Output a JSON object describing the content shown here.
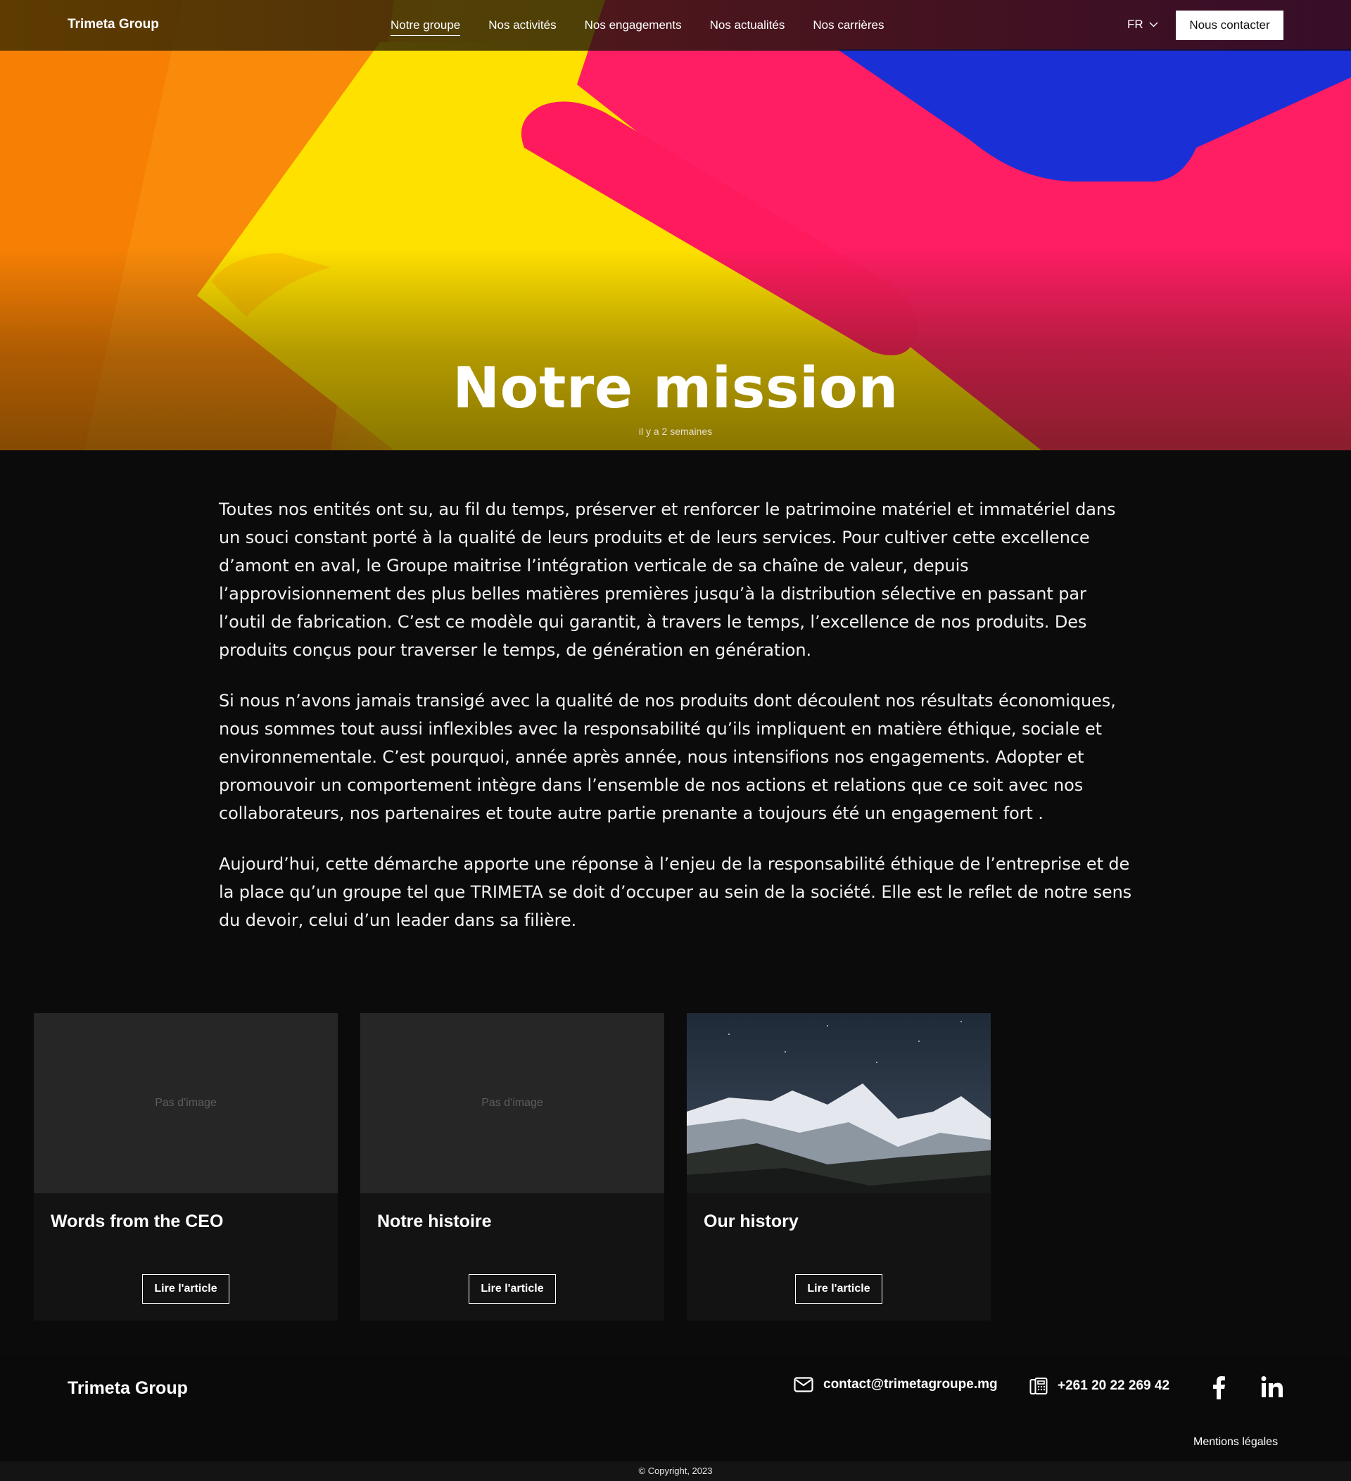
{
  "header": {
    "logo": "Trimeta Group",
    "nav": [
      {
        "label": "Notre groupe",
        "active": true
      },
      {
        "label": "Nos activités",
        "active": false
      },
      {
        "label": "Nos engagements",
        "active": false
      },
      {
        "label": "Nos actualités",
        "active": false
      },
      {
        "label": "Nos carrières",
        "active": false
      }
    ],
    "language": "FR",
    "contact_button": "Nous contacter"
  },
  "hero": {
    "title": "Notre mission",
    "date": "il y a 2 semaines"
  },
  "article": {
    "paragraphs": [
      "Toutes nos entités ont su, au fil du temps, préserver et renforcer le patrimoine matériel et immatériel dans un souci constant porté à la qualité de leurs produits et de leurs services. Pour cultiver cette excellence d’amont en aval, le Groupe maitrise l’intégration verticale de sa chaîne de valeur, depuis l’approvisionnement des plus belles matières premières jusqu’à la distribution sélective en passant par l’outil de fabrication. C’est ce modèle qui garantit, à travers le temps, l’excellence de nos produits. Des produits conçus pour traverser le temps, de génération en génération.",
      "Si nous n’avons jamais transigé avec la qualité de nos produits dont découlent nos résultats économiques, nous sommes tout aussi inflexibles avec la responsabilité qu’ils impliquent en matière éthique, sociale et environnementale. C’est pourquoi, année après année, nous intensifions nos engagements. Adopter et promouvoir un comportement intègre dans l’ensemble de nos actions et relations que ce soit avec nos collaborateurs, nos partenaires et toute autre partie prenante a toujours été un engagement fort .",
      "Aujourd’hui, cette démarche apporte une réponse à l’enjeu de la responsabilité éthique de l’entreprise et de la place qu’un groupe tel que TRIMETA se doit d’occuper au sein de la société. Elle est le reflet de notre sens du devoir, celui d’un leader dans sa filière."
    ]
  },
  "cards": [
    {
      "title": "Words from the CEO",
      "image_placeholder": "Pas d'image",
      "button": "Lire l'article"
    },
    {
      "title": "Notre histoire",
      "image_placeholder": "Pas d'image",
      "button": "Lire l'article"
    },
    {
      "title": "Our history",
      "image_placeholder": "",
      "button": "Lire l'article"
    }
  ],
  "footer": {
    "logo": "Trimeta Group",
    "email": "contact@trimetagroupe.mg",
    "phone": "+261 20 22 269 42",
    "icons": [
      "mail-icon",
      "phone-icon",
      "facebook-icon",
      "linkedin-icon"
    ],
    "legal": "Mentions légales",
    "copyright": "© Copyright, 2023"
  },
  "colors": {
    "background": "#0b0b0b",
    "card": "#131313",
    "thumb_placeholder": "#262626",
    "hero_orange": "#ff9a10",
    "hero_yellow": "#ffe600",
    "hero_pink": "#ff1f6a",
    "hero_blue": "#1a2ad0"
  }
}
